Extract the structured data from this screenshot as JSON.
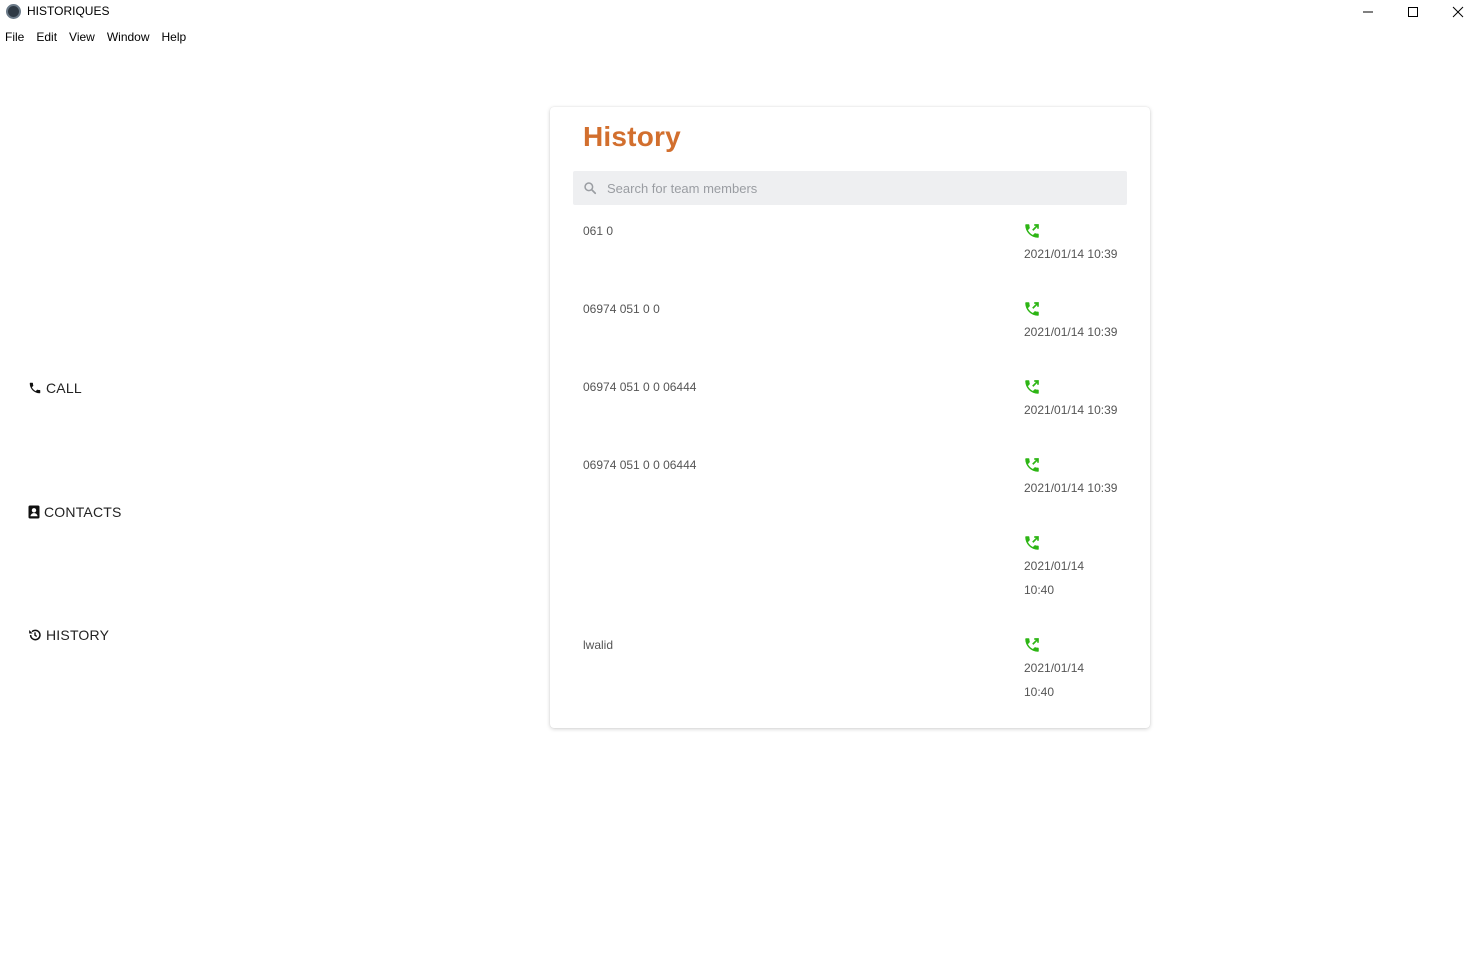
{
  "window": {
    "title": "HISTORIQUES"
  },
  "menu": [
    "File",
    "Edit",
    "View",
    "Window",
    "Help"
  ],
  "nav": [
    {
      "label": "CALL",
      "icon": "phone-icon"
    },
    {
      "label": "CONTACTS",
      "icon": "contact-card-icon"
    },
    {
      "label": "HISTORY",
      "icon": "history-icon"
    }
  ],
  "history": {
    "title": "History",
    "search_placeholder": "Search for team members",
    "accent_color": "#d26f2e",
    "call_icon_color": "#2db514",
    "entries": [
      {
        "number": "061 0",
        "datetime": "2021/01/14 10:39"
      },
      {
        "number": "06974 051 0 0",
        "datetime": "2021/01/14 10:39"
      },
      {
        "number": "06974 051 0 0 06444",
        "datetime": "2021/01/14 10:39"
      },
      {
        "number": "06974 051 0 0 06444",
        "datetime": "2021/01/14 10:39"
      },
      {
        "number": "",
        "datetime": "2021/01/14 10:40"
      },
      {
        "number": "lwalid",
        "datetime": "2021/01/14 10:40"
      }
    ]
  }
}
